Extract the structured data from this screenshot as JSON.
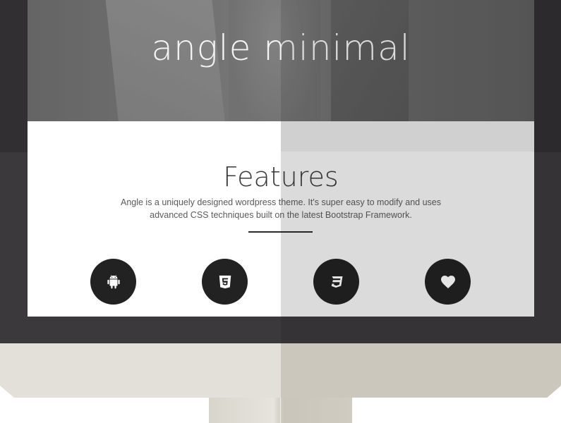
{
  "hero": {
    "title": "angle minimal"
  },
  "features": {
    "title": "Features",
    "description": "Angle is a uniquely designed wordpress theme. It's super easy to modify and uses advanced CSS techniques built on the latest Bootstrap Framework.",
    "icons": [
      "android-icon",
      "html5-icon",
      "css3-icon",
      "heart-icon"
    ]
  },
  "colors": {
    "bezel": "#3c393d",
    "icon_circle": "#222222",
    "chin": "#e2e0d8"
  }
}
